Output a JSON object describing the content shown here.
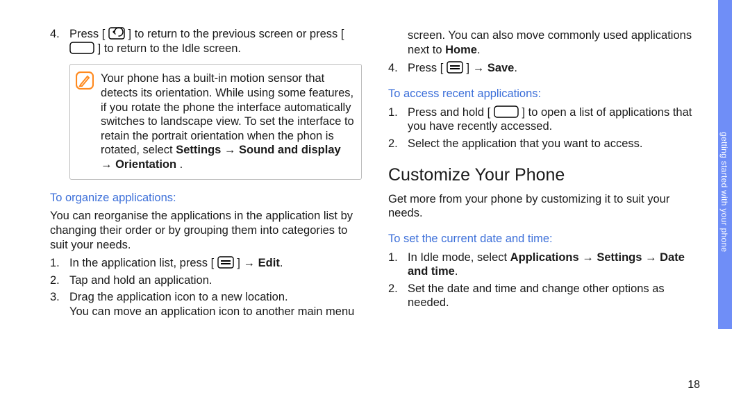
{
  "side_tab": "getting started with your phone",
  "page_number": "18",
  "left": {
    "step4_a": "Press [",
    "step4_b": "] to return to the previous screen or press [",
    "step4_c": "] to return to the Idle screen.",
    "note_a": "Your phone has a built-in motion sensor that detects its orientation. While using some features, if you rotate the phone the interface automatically switches to landscape view. To set the interface to retain the portrait orientation when the phon is rotated, select ",
    "note_b_bold": "Settings → Sound and display → Orientation",
    "note_b_end": " .",
    "sub1": "To organize applications:",
    "p1": "You can reorganise the applications in the application list by changing their order or by grouping them into categories to suit your needs.",
    "s1_a": "In the application list, press [",
    "s1_b": "] → ",
    "s1_c": "Edit",
    "s1_d": ".",
    "s2": "Tap and hold an application.",
    "s3": "Drag the application icon to a new location.\nYou can move an application icon to another main menu"
  },
  "right": {
    "top_a": "screen. You can also move commonly used applications next to ",
    "top_b_bold": "Home",
    "top_c": ".",
    "s4_a": "Press [",
    "s4_b": "] → ",
    "s4_c": "Save",
    "s4_d": ".",
    "sub2": "To access recent applications:",
    "r1_a": "Press and hold [",
    "r1_b": "] to open a list of applications that you have recently accessed.",
    "r2": "Select the application that you want to access.",
    "h2": "Customize Your Phone",
    "p2": "Get more from your phone by customizing it to suit your needs.",
    "sub3": "To set the current date and time:",
    "d1_a": "In Idle mode, select ",
    "d1_b": "Applications → Settings → Date and time",
    "d1_c": ".",
    "d2": "Set the date and time and change other options as needed."
  }
}
